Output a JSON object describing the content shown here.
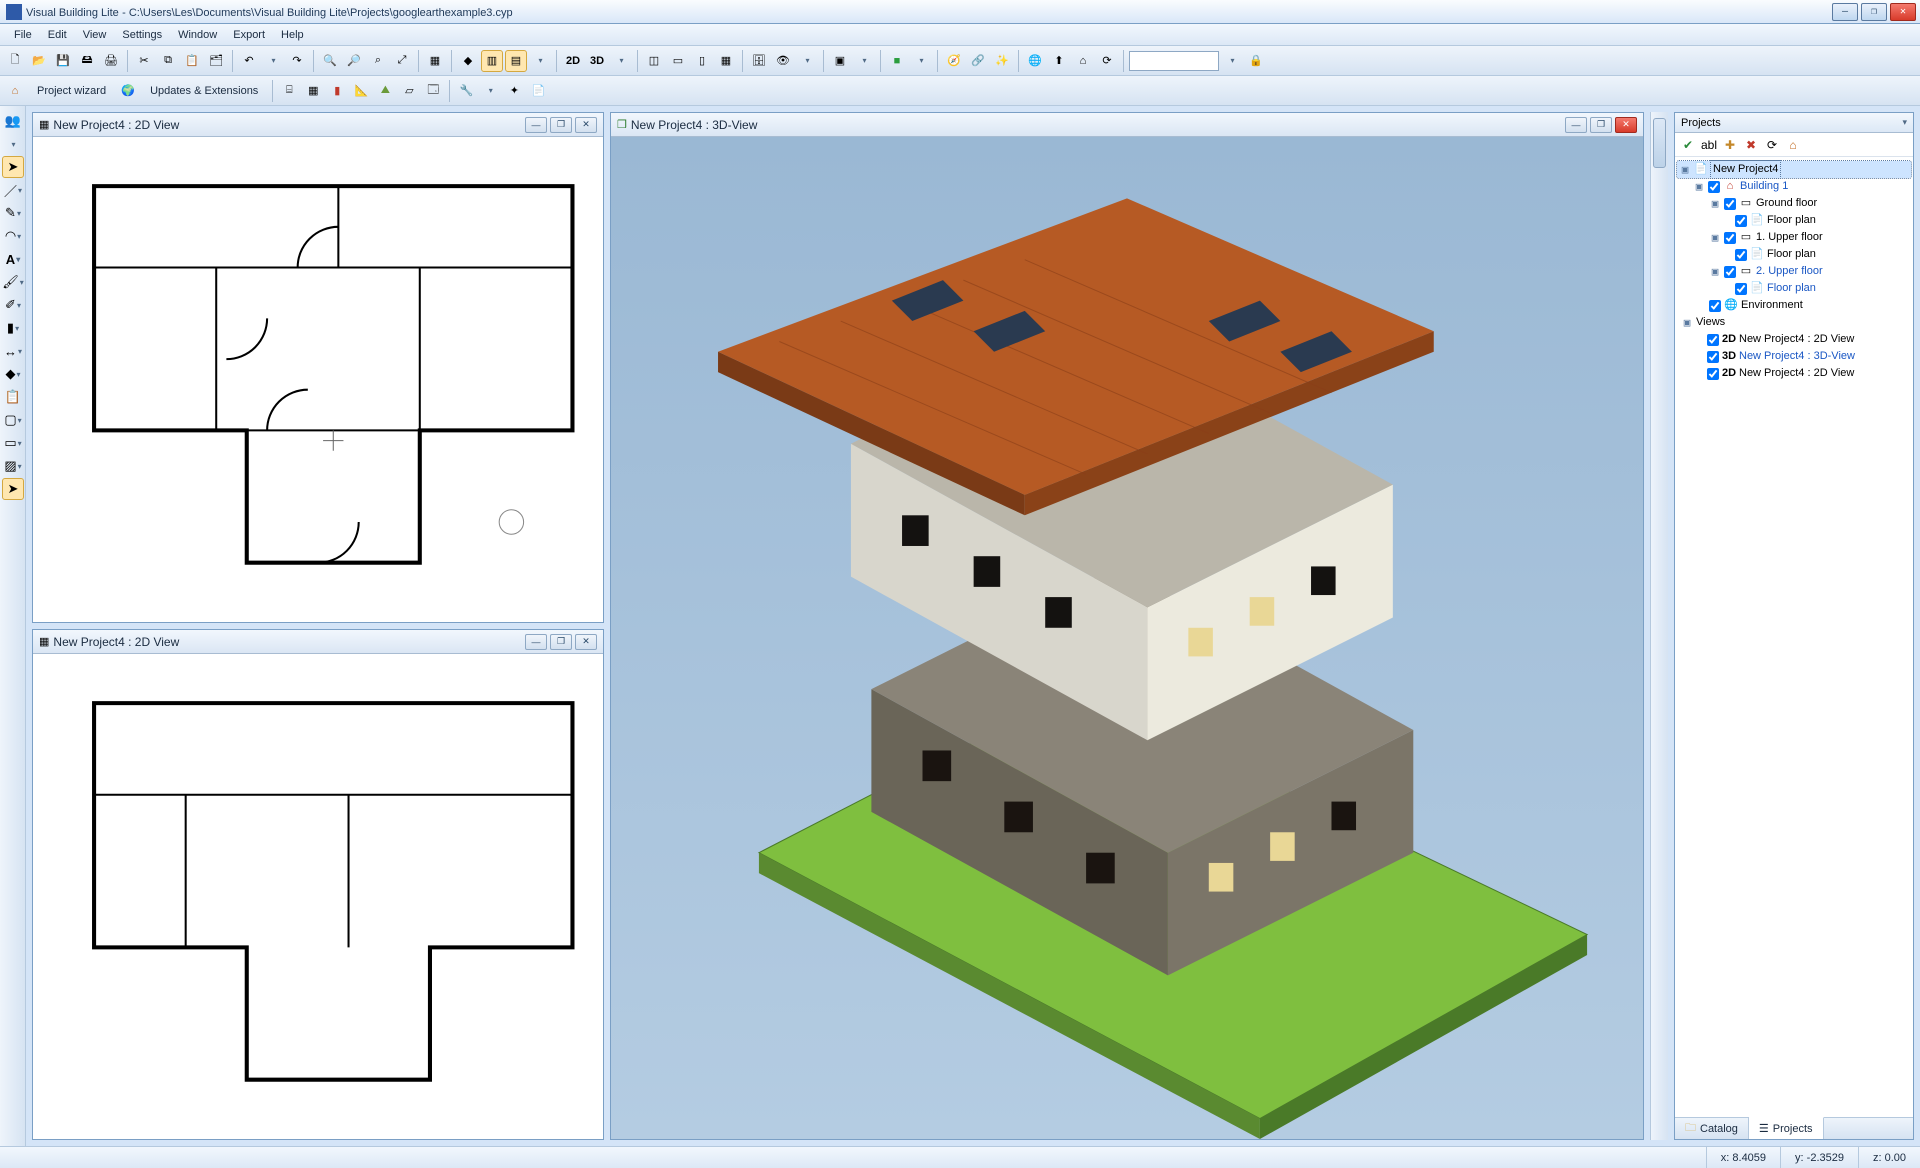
{
  "app": {
    "name": "Visual Building Lite",
    "file_path": "C:\\Users\\Les\\Documents\\Visual Building Lite\\Projects\\googlearthexample3.cyp"
  },
  "menus": [
    "File",
    "Edit",
    "View",
    "Settings",
    "Window",
    "Export",
    "Help"
  ],
  "toolbar_row1": {
    "text2d": "2D",
    "text3d": "3D"
  },
  "toolbar_row2": {
    "project_wizard": "Project wizard",
    "updates_extensions": "Updates & Extensions"
  },
  "subwindows": {
    "plan_a": {
      "title": "New Project4 : 2D View"
    },
    "plan_b": {
      "title": "New Project4 : 2D View"
    },
    "view3d": {
      "title": "New Project4 : 3D-View"
    }
  },
  "projects_panel": {
    "title": "Projects",
    "root": "New Project4",
    "building": "Building 1",
    "ground_floor": "Ground floor",
    "floor_plan": "Floor plan",
    "upper_floor1": "1. Upper floor",
    "upper_floor2": "2. Upper floor",
    "environment": "Environment",
    "views_label": "Views",
    "views": [
      {
        "tag": "2D",
        "label": "New Project4 : 2D View"
      },
      {
        "tag": "3D",
        "label": "New Project4 : 3D-View"
      },
      {
        "tag": "2D",
        "label": "New Project4 : 2D View"
      }
    ]
  },
  "tabs": {
    "catalog": "Catalog",
    "projects": "Projects"
  },
  "status": {
    "x": "x: 8.4059",
    "y": "y: -2.3529",
    "z": "z: 0.00"
  },
  "colors": {
    "accent": "#3a72b5",
    "close": "#d83b2b",
    "link": "#1a57c4"
  }
}
